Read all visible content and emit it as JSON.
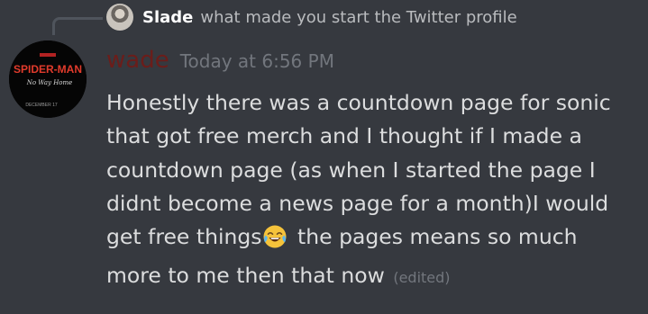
{
  "reply": {
    "author": "Slade",
    "text": "what made you start the Twitter profile"
  },
  "message": {
    "author": "wade",
    "timestamp": "Today at 6:56 PM",
    "content_before_emoji": "Honestly there was a countdown page for sonic that got free merch and I thought if I made a countdown page (as when I started the page I didnt become a news page for a month)I would get free things",
    "emoji": "joy-emoji",
    "content_after_emoji": " the pages means so much more to me then that now",
    "edited_label": "(edited)"
  },
  "avatar": {
    "title_text": "SPIDER-MAN",
    "subtitle_text": "No Way Home",
    "date_text": "DECEMBER 17"
  },
  "colors": {
    "background": "#36393f",
    "author_color": "#6b1d1a",
    "message_text": "#dcddde",
    "muted_text": "#72767d"
  }
}
